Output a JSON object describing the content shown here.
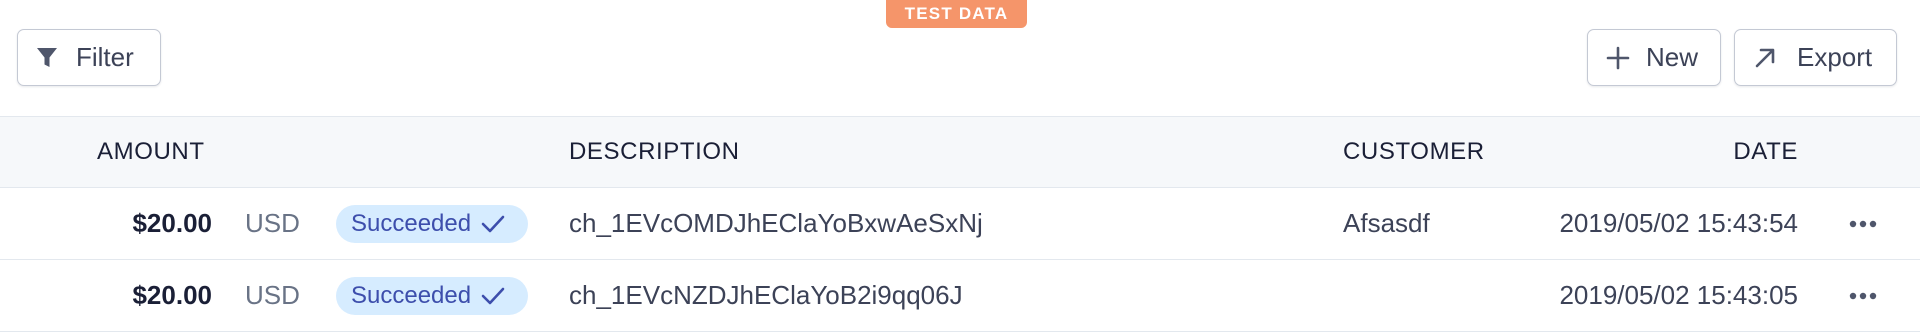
{
  "badge": {
    "label": "TEST DATA",
    "color": "#f5956a"
  },
  "toolbar": {
    "filter_label": "Filter",
    "new_label": "New",
    "export_label": "Export"
  },
  "table": {
    "headers": {
      "amount": "AMOUNT",
      "description": "DESCRIPTION",
      "customer": "CUSTOMER",
      "date": "DATE"
    },
    "rows": [
      {
        "amount": "$20.00",
        "currency": "USD",
        "status": "Succeeded",
        "description": "ch_1EVcOMDJhEClaYoBxwAeSxNj",
        "customer": "Afsasdf",
        "date": "2019/05/02 15:43:54"
      },
      {
        "amount": "$20.00",
        "currency": "USD",
        "status": "Succeeded",
        "description": "ch_1EVcNZDJhEClaYoB2i9qq06J",
        "customer": "",
        "date": "2019/05/02 15:43:05"
      }
    ]
  },
  "icons": {
    "filter": "filter-icon",
    "new": "plus-icon",
    "export": "arrow-up-right-icon",
    "status": "checkmark-icon",
    "row_actions": "more-horizontal-icon"
  },
  "colors": {
    "status_bg": "#d6ecff",
    "status_text": "#3d4eac",
    "header_bg": "#f6f8fa"
  }
}
